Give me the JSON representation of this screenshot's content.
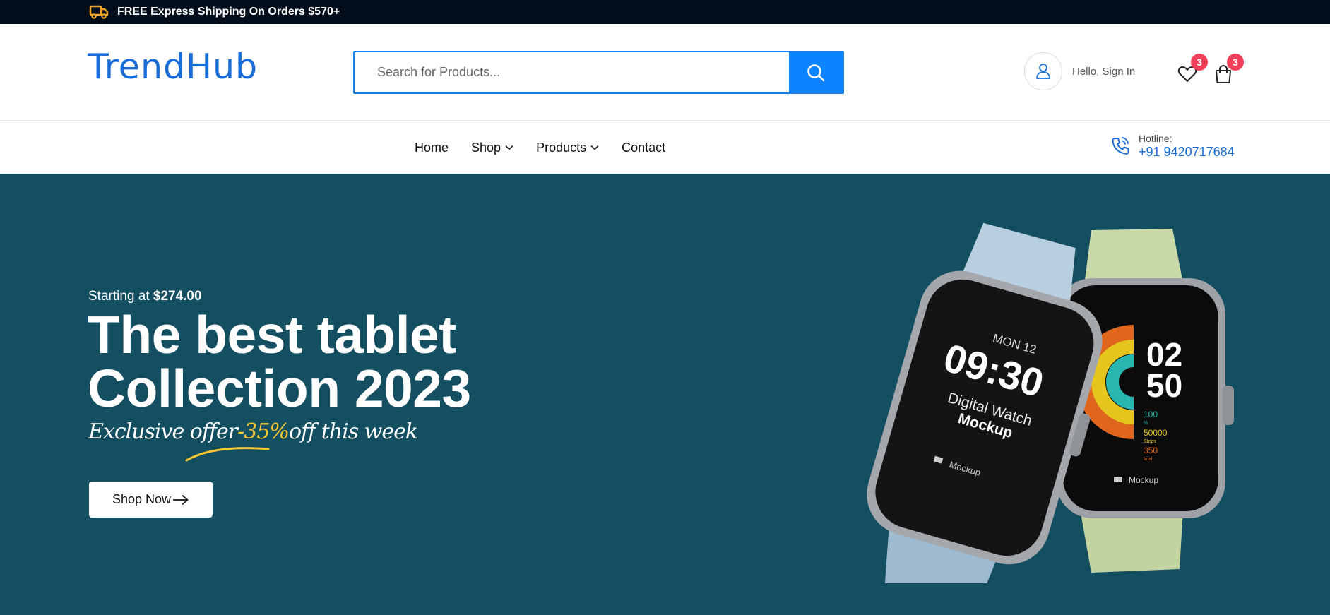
{
  "topbar": {
    "promo": "FREE Express Shipping On Orders $570+",
    "icon": "truck-icon"
  },
  "header": {
    "logo": "TrendHub",
    "search_placeholder": "Search for Products...",
    "account_label": "Hello, Sign In",
    "wishlist_count": "3",
    "cart_count": "3"
  },
  "nav": {
    "items": [
      {
        "label": "Home",
        "dropdown": false
      },
      {
        "label": "Shop",
        "dropdown": true
      },
      {
        "label": "Products",
        "dropdown": true
      },
      {
        "label": "Contact",
        "dropdown": false
      }
    ],
    "hotline_label": "Hotline:",
    "hotline_number": "+91 9420717684"
  },
  "hero": {
    "starting_prefix": "Starting at ",
    "starting_price": "$274.00",
    "headline_line1": "The best tablet",
    "headline_line2": "Collection 2023",
    "offer_prefix": "Exclusive offer",
    "offer_pct": "-35%",
    "offer_suffix": "off this week",
    "cta": "Shop Now",
    "watch1": {
      "day": "MON 12",
      "time": "09:30",
      "line1": "Digital Watch",
      "line2": "Mockup",
      "brand": "Mockup"
    },
    "watch2": {
      "hour": "02",
      "minute": "50",
      "stat1": "100",
      "stat1_unit": "%",
      "stat2": "50000",
      "stat2_unit": "Steps",
      "stat3": "350",
      "stat3_unit": "kcal",
      "brand": "Mockup"
    }
  },
  "colors": {
    "accent": "#0d84ff",
    "brand": "#1a6dd6",
    "topbar_bg": "#020d1c",
    "hero_bg": "#134e61",
    "badge": "#f0405a",
    "offer_highlight": "#f7c531",
    "truck": "#f5a623"
  }
}
